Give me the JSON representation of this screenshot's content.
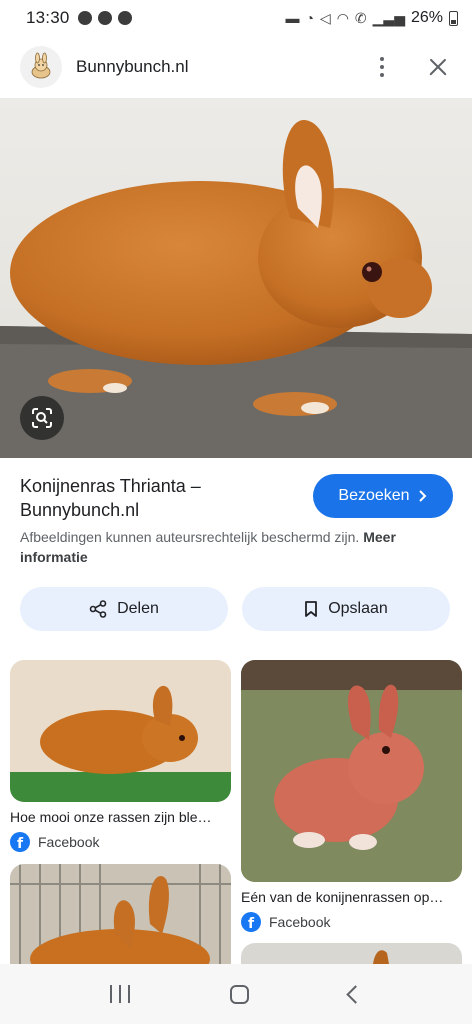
{
  "status_bar": {
    "time": "13:30",
    "battery": "26%"
  },
  "header": {
    "site_name": "Bunnybunch.nl",
    "favicon": "bunny-logo-icon"
  },
  "main": {
    "title": "Konijnenras Thrianta – Bunnybunch.nl",
    "visit_label": "Bezoeken",
    "notice_text": "Afbeeldingen kunnen auteursrechtelijk beschermd zijn.",
    "notice_link": "Meer informatie",
    "share_label": "Delen",
    "save_label": "Opslaan"
  },
  "related": [
    {
      "caption": "Hoe mooi onze rassen zijn ble…",
      "source": "Facebook"
    },
    {
      "caption": "Eén van de konijnenrassen op…",
      "source": "Facebook"
    }
  ],
  "colors": {
    "accent": "#1a73e8",
    "chip_bg": "#e8f0fe",
    "facebook": "#1877f2"
  }
}
